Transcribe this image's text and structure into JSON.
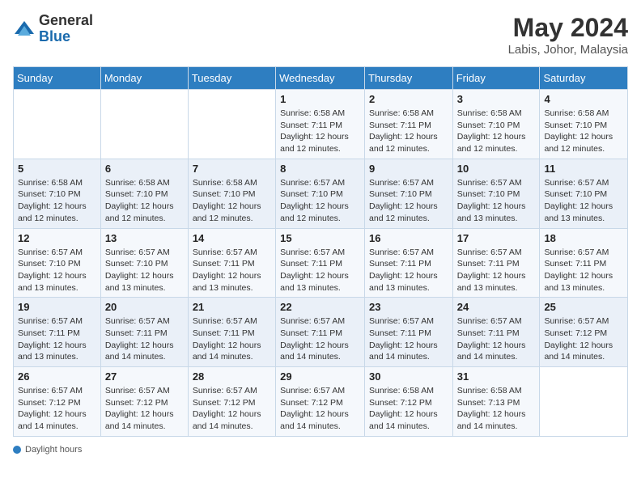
{
  "header": {
    "logo_general": "General",
    "logo_blue": "Blue",
    "month_year": "May 2024",
    "location": "Labis, Johor, Malaysia"
  },
  "days_of_week": [
    "Sunday",
    "Monday",
    "Tuesday",
    "Wednesday",
    "Thursday",
    "Friday",
    "Saturday"
  ],
  "weeks": [
    [
      {
        "day": "",
        "info": ""
      },
      {
        "day": "",
        "info": ""
      },
      {
        "day": "",
        "info": ""
      },
      {
        "day": "1",
        "info": "Sunrise: 6:58 AM\nSunset: 7:11 PM\nDaylight: 12 hours and 12 minutes."
      },
      {
        "day": "2",
        "info": "Sunrise: 6:58 AM\nSunset: 7:11 PM\nDaylight: 12 hours and 12 minutes."
      },
      {
        "day": "3",
        "info": "Sunrise: 6:58 AM\nSunset: 7:10 PM\nDaylight: 12 hours and 12 minutes."
      },
      {
        "day": "4",
        "info": "Sunrise: 6:58 AM\nSunset: 7:10 PM\nDaylight: 12 hours and 12 minutes."
      }
    ],
    [
      {
        "day": "5",
        "info": "Sunrise: 6:58 AM\nSunset: 7:10 PM\nDaylight: 12 hours and 12 minutes."
      },
      {
        "day": "6",
        "info": "Sunrise: 6:58 AM\nSunset: 7:10 PM\nDaylight: 12 hours and 12 minutes."
      },
      {
        "day": "7",
        "info": "Sunrise: 6:58 AM\nSunset: 7:10 PM\nDaylight: 12 hours and 12 minutes."
      },
      {
        "day": "8",
        "info": "Sunrise: 6:57 AM\nSunset: 7:10 PM\nDaylight: 12 hours and 12 minutes."
      },
      {
        "day": "9",
        "info": "Sunrise: 6:57 AM\nSunset: 7:10 PM\nDaylight: 12 hours and 12 minutes."
      },
      {
        "day": "10",
        "info": "Sunrise: 6:57 AM\nSunset: 7:10 PM\nDaylight: 12 hours and 13 minutes."
      },
      {
        "day": "11",
        "info": "Sunrise: 6:57 AM\nSunset: 7:10 PM\nDaylight: 12 hours and 13 minutes."
      }
    ],
    [
      {
        "day": "12",
        "info": "Sunrise: 6:57 AM\nSunset: 7:10 PM\nDaylight: 12 hours and 13 minutes."
      },
      {
        "day": "13",
        "info": "Sunrise: 6:57 AM\nSunset: 7:10 PM\nDaylight: 12 hours and 13 minutes."
      },
      {
        "day": "14",
        "info": "Sunrise: 6:57 AM\nSunset: 7:11 PM\nDaylight: 12 hours and 13 minutes."
      },
      {
        "day": "15",
        "info": "Sunrise: 6:57 AM\nSunset: 7:11 PM\nDaylight: 12 hours and 13 minutes."
      },
      {
        "day": "16",
        "info": "Sunrise: 6:57 AM\nSunset: 7:11 PM\nDaylight: 12 hours and 13 minutes."
      },
      {
        "day": "17",
        "info": "Sunrise: 6:57 AM\nSunset: 7:11 PM\nDaylight: 12 hours and 13 minutes."
      },
      {
        "day": "18",
        "info": "Sunrise: 6:57 AM\nSunset: 7:11 PM\nDaylight: 12 hours and 13 minutes."
      }
    ],
    [
      {
        "day": "19",
        "info": "Sunrise: 6:57 AM\nSunset: 7:11 PM\nDaylight: 12 hours and 13 minutes."
      },
      {
        "day": "20",
        "info": "Sunrise: 6:57 AM\nSunset: 7:11 PM\nDaylight: 12 hours and 14 minutes."
      },
      {
        "day": "21",
        "info": "Sunrise: 6:57 AM\nSunset: 7:11 PM\nDaylight: 12 hours and 14 minutes."
      },
      {
        "day": "22",
        "info": "Sunrise: 6:57 AM\nSunset: 7:11 PM\nDaylight: 12 hours and 14 minutes."
      },
      {
        "day": "23",
        "info": "Sunrise: 6:57 AM\nSunset: 7:11 PM\nDaylight: 12 hours and 14 minutes."
      },
      {
        "day": "24",
        "info": "Sunrise: 6:57 AM\nSunset: 7:11 PM\nDaylight: 12 hours and 14 minutes."
      },
      {
        "day": "25",
        "info": "Sunrise: 6:57 AM\nSunset: 7:12 PM\nDaylight: 12 hours and 14 minutes."
      }
    ],
    [
      {
        "day": "26",
        "info": "Sunrise: 6:57 AM\nSunset: 7:12 PM\nDaylight: 12 hours and 14 minutes."
      },
      {
        "day": "27",
        "info": "Sunrise: 6:57 AM\nSunset: 7:12 PM\nDaylight: 12 hours and 14 minutes."
      },
      {
        "day": "28",
        "info": "Sunrise: 6:57 AM\nSunset: 7:12 PM\nDaylight: 12 hours and 14 minutes."
      },
      {
        "day": "29",
        "info": "Sunrise: 6:57 AM\nSunset: 7:12 PM\nDaylight: 12 hours and 14 minutes."
      },
      {
        "day": "30",
        "info": "Sunrise: 6:58 AM\nSunset: 7:12 PM\nDaylight: 12 hours and 14 minutes."
      },
      {
        "day": "31",
        "info": "Sunrise: 6:58 AM\nSunset: 7:13 PM\nDaylight: 12 hours and 14 minutes."
      },
      {
        "day": "",
        "info": ""
      }
    ]
  ],
  "footer": {
    "daylight_label": "Daylight hours"
  }
}
